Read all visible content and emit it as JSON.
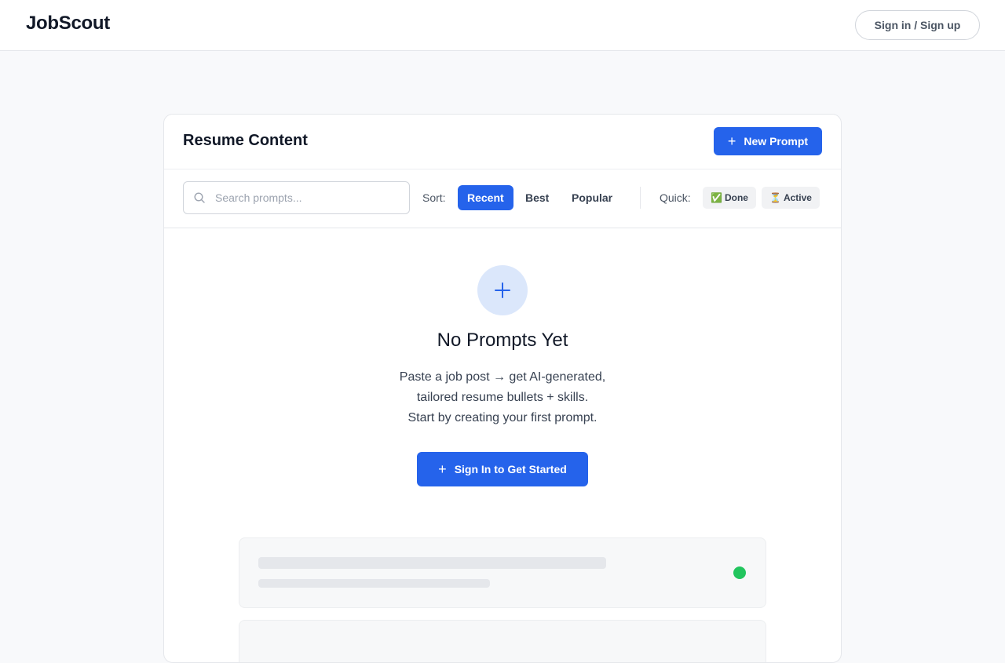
{
  "header": {
    "brand": "JobScout",
    "signin_label": "Sign in / Sign up"
  },
  "card": {
    "title": "Resume Content",
    "new_prompt_label": "New Prompt"
  },
  "toolbar": {
    "search_placeholder": "Search prompts...",
    "sort_label": "Sort:",
    "sort_options": [
      "Recent",
      "Best",
      "Popular"
    ],
    "sort_selected": "Recent",
    "quick_label": "Quick:",
    "quick_filters": [
      {
        "emoji": "✅",
        "label": "Done"
      },
      {
        "emoji": "⏳",
        "label": "Active"
      }
    ]
  },
  "empty_state": {
    "icon": "plus-icon",
    "title": "No Prompts Yet",
    "lines": [
      "Paste a job post → get AI-generated,",
      "tailored resume bullets + skills.",
      "Start by creating your first prompt."
    ],
    "cta_label": "Sign In to Get Started"
  },
  "colors": {
    "accent": "#2563eb",
    "accent_soft": "#dbe7fb",
    "status_green": "#22c55e",
    "skeleton": "#e5e7eb"
  }
}
